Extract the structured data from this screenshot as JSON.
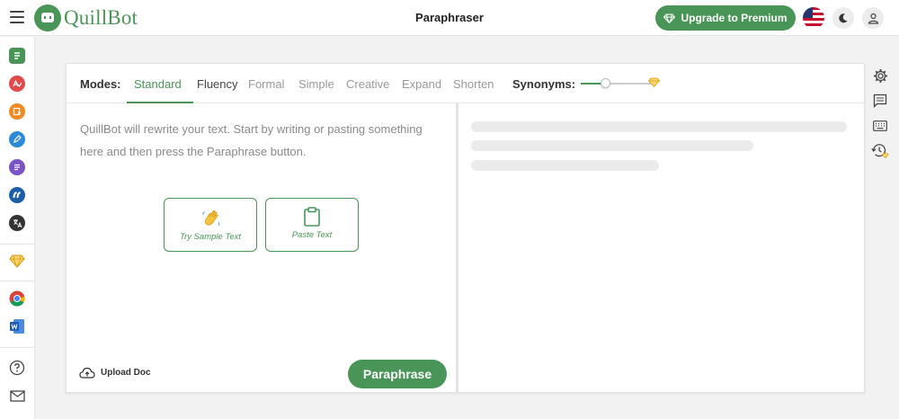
{
  "header": {
    "brand": "QuillBot",
    "page_title": "Paraphraser",
    "upgrade_label": "Upgrade to Premium"
  },
  "modes": {
    "label": "Modes:",
    "tabs": [
      {
        "label": "Standard",
        "state": "active"
      },
      {
        "label": "Fluency",
        "state": "enabled"
      },
      {
        "label": "Formal",
        "state": "locked"
      },
      {
        "label": "Simple",
        "state": "locked"
      },
      {
        "label": "Creative",
        "state": "locked"
      },
      {
        "label": "Expand",
        "state": "locked"
      },
      {
        "label": "Shorten",
        "state": "locked"
      }
    ],
    "synonyms_label": "Synonyms:",
    "synonyms_level": 0.35
  },
  "input": {
    "placeholder": "QuillBot will rewrite your text. Start by writing or pasting something here and then press the Paraphrase button."
  },
  "actions": {
    "try_sample": "Try Sample Text",
    "paste": "Paste Text"
  },
  "footer": {
    "upload_label": "Upload Doc",
    "paraphrase_label": "Paraphrase"
  },
  "left_sidebar": {
    "items": [
      {
        "name": "paraphraser",
        "color": "#499557"
      },
      {
        "name": "grammar-checker",
        "color": "#e04a4a"
      },
      {
        "name": "plagiarism-checker",
        "color": "#f28a22"
      },
      {
        "name": "co-writer",
        "color": "#2d8ad8"
      },
      {
        "name": "summarizer",
        "color": "#7a54c4"
      },
      {
        "name": "citation-generator",
        "color": "#1e5ea8"
      },
      {
        "name": "translator",
        "color": "#333333"
      }
    ]
  },
  "colors": {
    "brand": "#499557",
    "premium_gold": "#f0b429"
  }
}
